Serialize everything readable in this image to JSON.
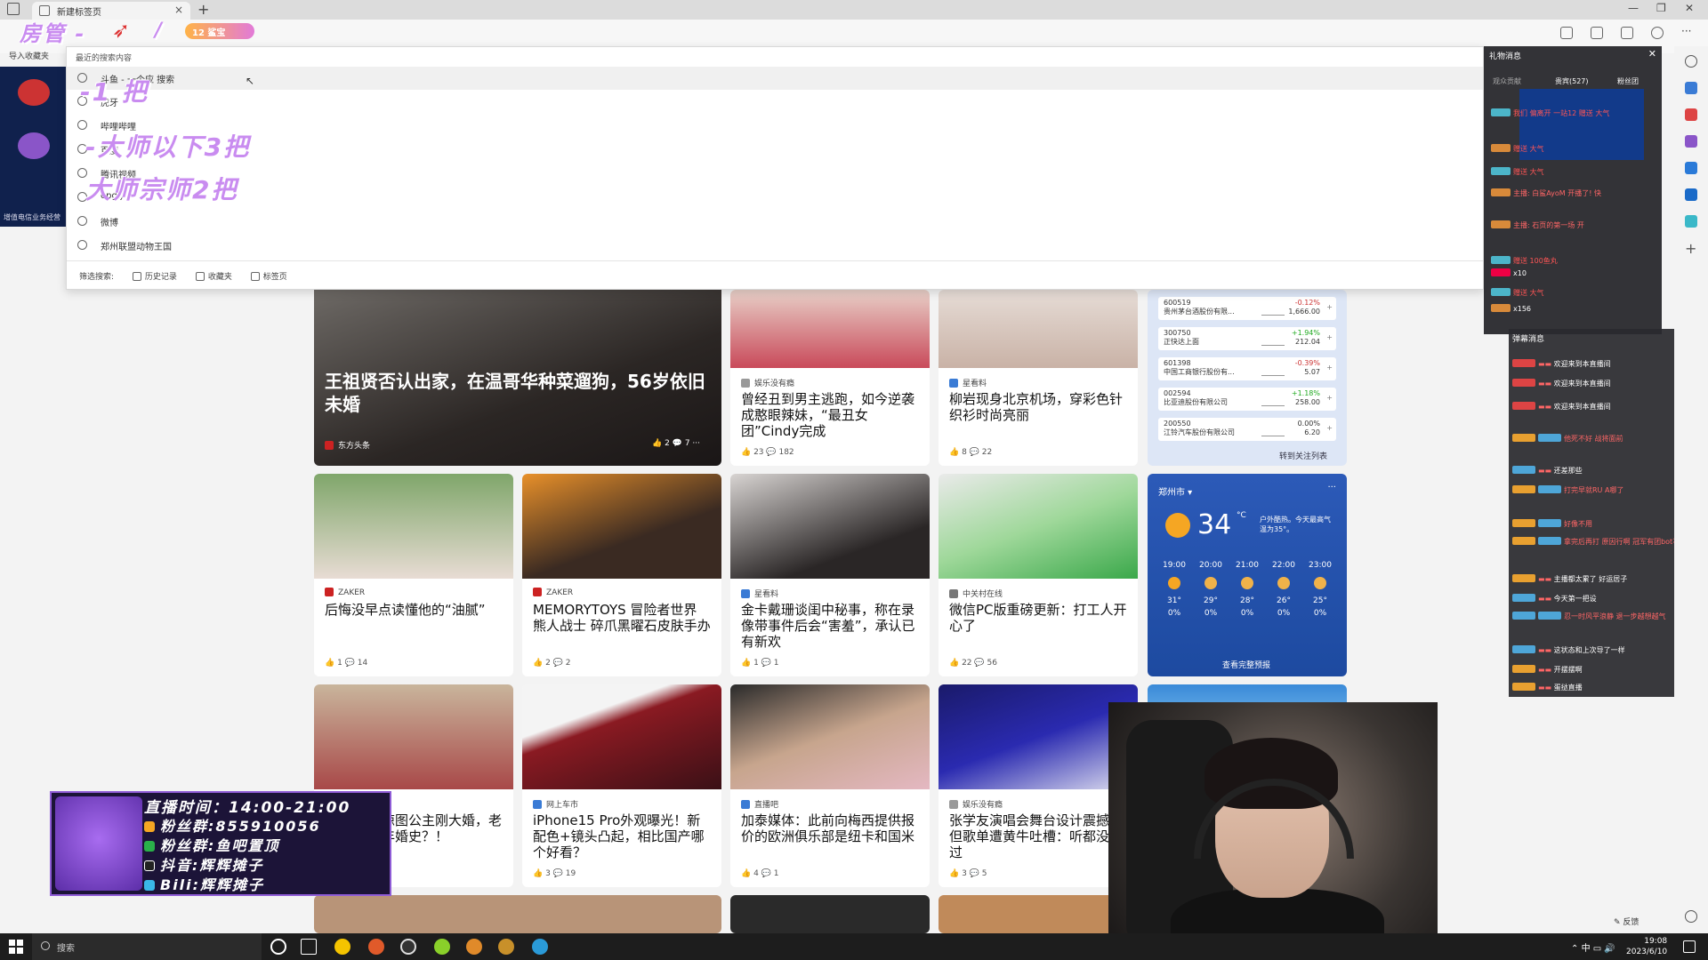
{
  "browser": {
    "tab_title": "新建标签页",
    "new_tab": "+",
    "fav_import": "导入收藏夹",
    "win_min": "—",
    "win_max": "❐",
    "win_close": "✕"
  },
  "dropdown": {
    "header": "最近的搜索内容",
    "items": [
      "斗鱼 - 一个应 搜索",
      "虎牙",
      "哔哩哔哩",
      "百度",
      "腾讯视频",
      "opgg",
      "微博",
      "郑州联盟动物王国"
    ],
    "filter_label": "筛选搜索:",
    "filters": [
      "历史记录",
      "收藏夹",
      "标签页"
    ]
  },
  "overlay": {
    "top_text": "房管 -",
    "slash": "/",
    "badge": "12 鲨宝",
    "line1": "-1 把",
    "line2": "-大师以下3把",
    "line3": "大师宗师2把"
  },
  "left_ad": "增值电信业务经营",
  "hero": {
    "title": "王祖贤否认出家，在温哥华种菜遛狗，56岁依旧未婚",
    "source": "东方头条",
    "likes": "2",
    "comments": "7"
  },
  "cards": [
    {
      "source": "娱乐没有瘾",
      "title": "曾经丑到男主逃跑，如今逆袭成憨眼辣妹，“最丑女团”Cindy完成",
      "likes": "23",
      "comments": "182"
    },
    {
      "source": "星看料",
      "title": "柳岩现身北京机场，穿彩色针织衫时尚亮丽",
      "likes": "8",
      "comments": "22"
    },
    {
      "source": "ZAKER",
      "title": "后悔没早点读懂他的“油腻”",
      "likes": "1",
      "comments": "14"
    },
    {
      "source": "ZAKER",
      "title": "MEMORYTOYS 冒险者世界 熊人战士 碎爪黑曜石皮肤手办",
      "likes": "2",
      "comments": "2"
    },
    {
      "source": "星看料",
      "title": "金卡戴珊谈闺中秘事，称在录像带事件后会“害羞”，承认已有新欢",
      "likes": "1",
      "comments": "1"
    },
    {
      "source": "中关村在线",
      "title": "微信PC版重磅更新：打工人开心了",
      "likes": "22",
      "comments": "56"
    },
    {
      "source": "",
      "title": "琼图公主刚大婚，老年婚史？！",
      "likes": "1",
      "comments": "3"
    },
    {
      "source": "网上车市",
      "title": "iPhone15 Pro外观曝光！新配色+镜头凸起，相比国产哪个好看？",
      "likes": "3",
      "comments": "19"
    },
    {
      "source": "直播吧",
      "title": "加泰媒体：此前向梅西提供报价的欧洲俱乐部是纽卡和国米",
      "likes": "4",
      "comments": "1"
    },
    {
      "source": "娱乐没有瘾",
      "title": "张学友演唱会舞台设计震撼，但歌单遭黄牛吐槽：听都没听过",
      "likes": "3",
      "comments": "5"
    }
  ],
  "stocks": {
    "items": [
      {
        "code": "600519",
        "name": "贵州茅台酒股份有限...",
        "pct": "-0.12%",
        "price": "1,666.00"
      },
      {
        "code": "300750",
        "name": "正快达上面",
        "pct": "+1.94%",
        "price": "212.04"
      },
      {
        "code": "601398",
        "name": "中国工商银行股份有...",
        "pct": "-0.39%",
        "price": "5.07"
      },
      {
        "code": "002594",
        "name": "比亚迪股份有限公司",
        "pct": "+1.18%",
        "price": "258.00"
      },
      {
        "code": "200550",
        "name": "江铃汽车股份有限公司",
        "pct": "0.00%",
        "price": "6.20"
      }
    ],
    "more": "转到关注列表"
  },
  "weather": {
    "city": "郑州市",
    "temp": "34",
    "unit": "°C",
    "desc": "户外酷热。今天最高气温为35°。",
    "hours": [
      {
        "t": "19:00",
        "v": "31°",
        "r": "0%"
      },
      {
        "t": "20:00",
        "v": "29°",
        "r": "0%"
      },
      {
        "t": "21:00",
        "v": "28°",
        "r": "0%"
      },
      {
        "t": "22:00",
        "v": "26°",
        "r": "0%"
      },
      {
        "t": "23:00",
        "v": "25°",
        "r": "0%"
      }
    ],
    "more": "查看完整预报"
  },
  "gift_panel": {
    "title": "礼物消息",
    "tabs": [
      "观众贡献",
      "贵宾(527)",
      "粉丝团"
    ],
    "lines": [
      "我们 偏离开 一站12 赠送 大气",
      "赠送 大气",
      "赠送 大气",
      "赠送 大气",
      "主播: 白鲨AyoM 开播了! 快",
      "主播: 石页的第一场 开",
      "赠送 100鱼丸",
      "x10",
      "赠送 大气",
      "x156"
    ]
  },
  "chat_panel": {
    "title": "弹幕消息",
    "lines": [
      {
        "text": "欢迎来到本直播间"
      },
      {
        "text": "欢迎来到本直播间"
      },
      {
        "text": "欢迎来到本直播间"
      },
      {
        "text": "他死不好 战将面前"
      },
      {
        "text": "还差那些"
      },
      {
        "text": "打完早就RU A哪了"
      },
      {
        "text": "好像不用"
      },
      {
        "text": "拿完后再打 原因行啊 冠军有团bot不是"
      },
      {
        "text": "主播都太累了 好运居子"
      },
      {
        "text": "今天第一把设"
      },
      {
        "text": "忍一时风平浪静 退一步越想越气"
      },
      {
        "text": "这状态和上次导了一样"
      },
      {
        "text": "开摆摆啊"
      },
      {
        "text": "蛋挞直播"
      }
    ]
  },
  "stream_info": {
    "time": "直播时间：14:00-21:00",
    "fans1": "粉丝群:855910056",
    "fans2": "粉丝群:鱼吧置顶",
    "douyin": "抖音:辉辉摊子",
    "bili": "Bili:辉辉摊子"
  },
  "feedback": "反馈",
  "taskbar": {
    "search": "搜索",
    "time": "19:08",
    "date": "2023/6/10",
    "ime": "中"
  }
}
